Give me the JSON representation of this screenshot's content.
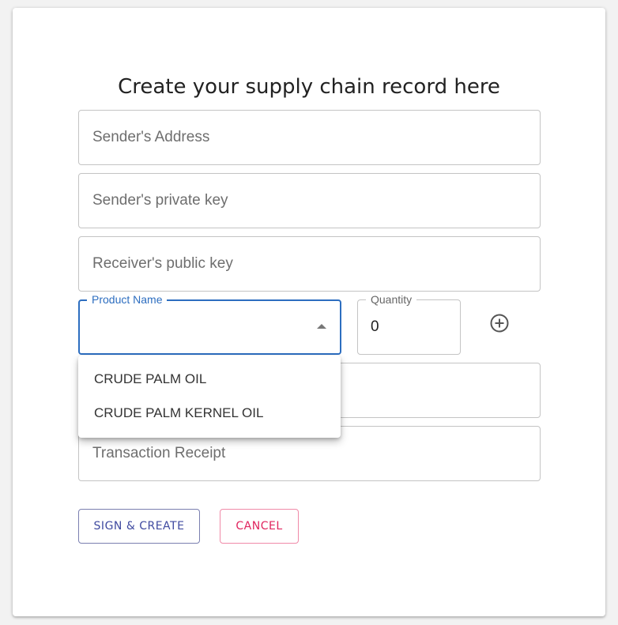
{
  "form": {
    "title": "Create your supply chain record here",
    "sender_address_placeholder": "Sender's Address",
    "sender_private_key_placeholder": "Sender's private key",
    "receiver_public_key_placeholder": "Receiver's public key",
    "product_name_label": "Product Name",
    "quantity_label": "Quantity",
    "quantity_value": "0",
    "transaction_receipt_placeholder": "Transaction Receipt"
  },
  "product_menu": {
    "options": [
      "CRUDE PALM OIL",
      "CRUDE PALM KERNEL OIL"
    ]
  },
  "buttons": {
    "sign_create": "SIGN & CREATE",
    "cancel": "CANCEL"
  },
  "colors": {
    "accent_blue": "#2d6ec0",
    "primary_indigo": "#3f4aa0",
    "cancel_pink": "#e0245e"
  },
  "icons": {
    "add": "plus-circle-icon",
    "dropdown": "arrow-drop-up-icon"
  }
}
